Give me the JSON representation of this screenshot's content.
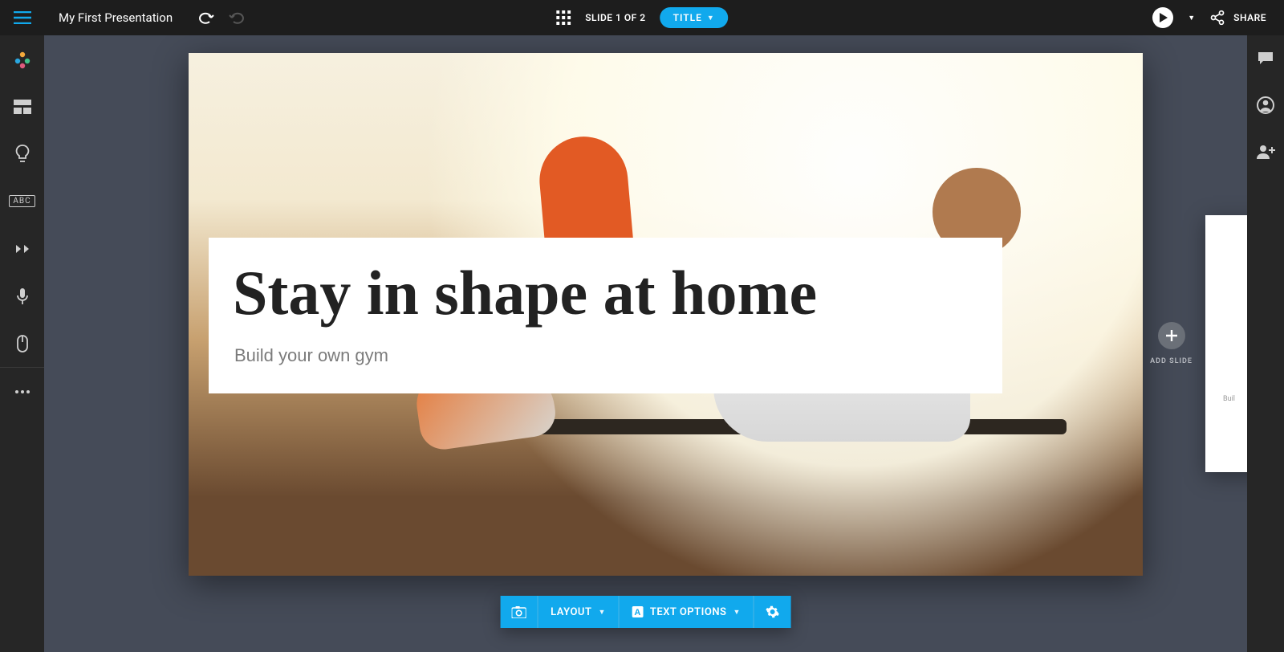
{
  "header": {
    "title": "My First Presentation",
    "slide_indicator": "SLIDE 1 OF 2",
    "mode_pill": "TITLE",
    "share_label": "SHARE"
  },
  "slide": {
    "headline": "Stay in shape at home",
    "subhead": "Build your own gym"
  },
  "bottom_toolbar": {
    "layout": "LAYOUT",
    "text_options": "TEXT OPTIONS"
  },
  "add_slide": {
    "label": "ADD SLIDE"
  },
  "next_thumb": {
    "subhead_fragment": "Buil"
  },
  "left_sidebar": {
    "abc": "ABC"
  }
}
